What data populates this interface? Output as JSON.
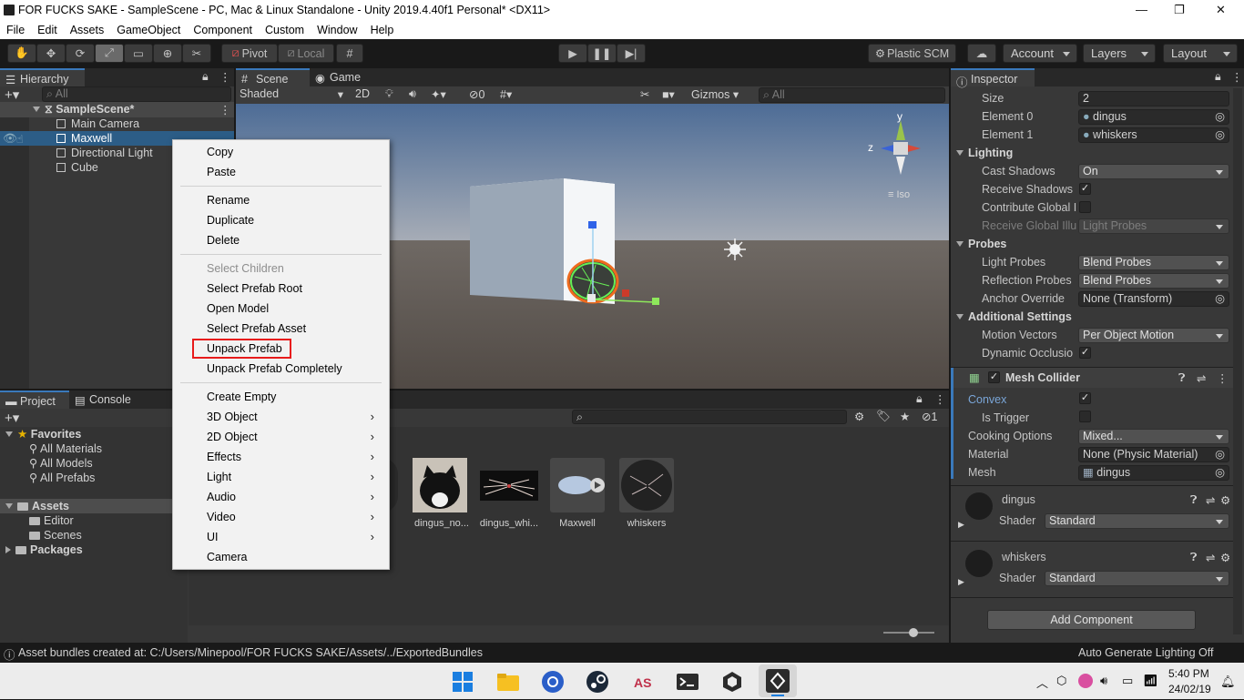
{
  "window": {
    "title": "FOR FUCKS SAKE - SampleScene - PC, Mac & Linux Standalone - Unity 2019.4.40f1 Personal* <DX11>",
    "minimize": "—",
    "maximize": "❐",
    "close": "✕"
  },
  "menu": [
    "File",
    "Edit",
    "Assets",
    "GameObject",
    "Component",
    "Custom",
    "Window",
    "Help"
  ],
  "toolbar": {
    "pivot": "Pivot",
    "local": "Local",
    "plastic": "Plastic SCM",
    "account": "Account",
    "layers": "Layers",
    "layout": "Layout"
  },
  "hierarchy": {
    "tab": "Hierarchy",
    "search": "All",
    "scene": "SampleScene*",
    "items": [
      "Main Camera",
      "Maxwell",
      "Directional Light",
      "Cube"
    ]
  },
  "scene": {
    "tab_scene": "Scene",
    "tab_game": "Game",
    "shading": "Shaded",
    "mode2d": "2D",
    "hidden_count": "0",
    "gizmos": "Gizmos",
    "search": "All",
    "iso": "Iso",
    "axis_y": "y",
    "axis_z": "z"
  },
  "context_menu": {
    "items": [
      "Copy",
      "Paste",
      "Rename",
      "Duplicate",
      "Delete",
      "Select Children",
      "Select Prefab Root",
      "Open Model",
      "Select Prefab Asset",
      "Unpack Prefab",
      "Unpack Prefab Completely",
      "Create Empty",
      "3D Object",
      "2D Object",
      "Effects",
      "Light",
      "Audio",
      "Video",
      "UI",
      "Camera"
    ],
    "highlight_color": "#e81b1b"
  },
  "project": {
    "tab_project": "Project",
    "tab_console": "Console",
    "favorites": "Favorites",
    "fav_items": [
      "All Materials",
      "All Models",
      "All Prefabs"
    ],
    "assets": "Assets",
    "asset_items": [
      "Editor",
      "Scenes"
    ],
    "packages": "Packages",
    "hidden_count": "1",
    "thumbs": [
      "dingus_no...",
      "dingus_whi...",
      "Maxwell",
      "whiskers"
    ]
  },
  "inspector": {
    "tab": "Inspector",
    "size_label": "Size",
    "size_value": "2",
    "element0_label": "Element 0",
    "element0_value": "dingus",
    "element1_label": "Element 1",
    "element1_value": "whiskers",
    "lighting": "Lighting",
    "cast_shadows_label": "Cast Shadows",
    "cast_shadows_value": "On",
    "receive_shadows_label": "Receive Shadows",
    "contribute_gi_label": "Contribute Global I",
    "receive_gi_label": "Receive Global Illu",
    "receive_gi_value": "Light Probes",
    "probes": "Probes",
    "light_probes_label": "Light Probes",
    "light_probes_value": "Blend Probes",
    "reflection_probes_label": "Reflection Probes",
    "reflection_probes_value": "Blend Probes",
    "anchor_label": "Anchor Override",
    "anchor_value": "None (Transform)",
    "additional": "Additional Settings",
    "motion_label": "Motion Vectors",
    "motion_value": "Per Object Motion",
    "dynamic_label": "Dynamic Occlusio",
    "mesh_collider": "Mesh Collider",
    "convex_label": "Convex",
    "is_trigger_label": "Is Trigger",
    "cooking_label": "Cooking Options",
    "cooking_value": "Mixed...",
    "material_label": "Material",
    "material_value": "None (Physic Material)",
    "mesh_label": "Mesh",
    "mesh_value": "dingus",
    "mat1_name": "dingus",
    "mat2_name": "whiskers",
    "shader_label": "Shader",
    "shader_value": "Standard",
    "add_component": "Add Component"
  },
  "status": {
    "message": "Asset bundles created at: C:/Users/Minepool/FOR FUCKS SAKE/Assets/../ExportedBundles",
    "lighting": "Auto Generate Lighting Off"
  },
  "taskbar": {
    "time": "5:40 PM",
    "date": "24/02/19"
  }
}
